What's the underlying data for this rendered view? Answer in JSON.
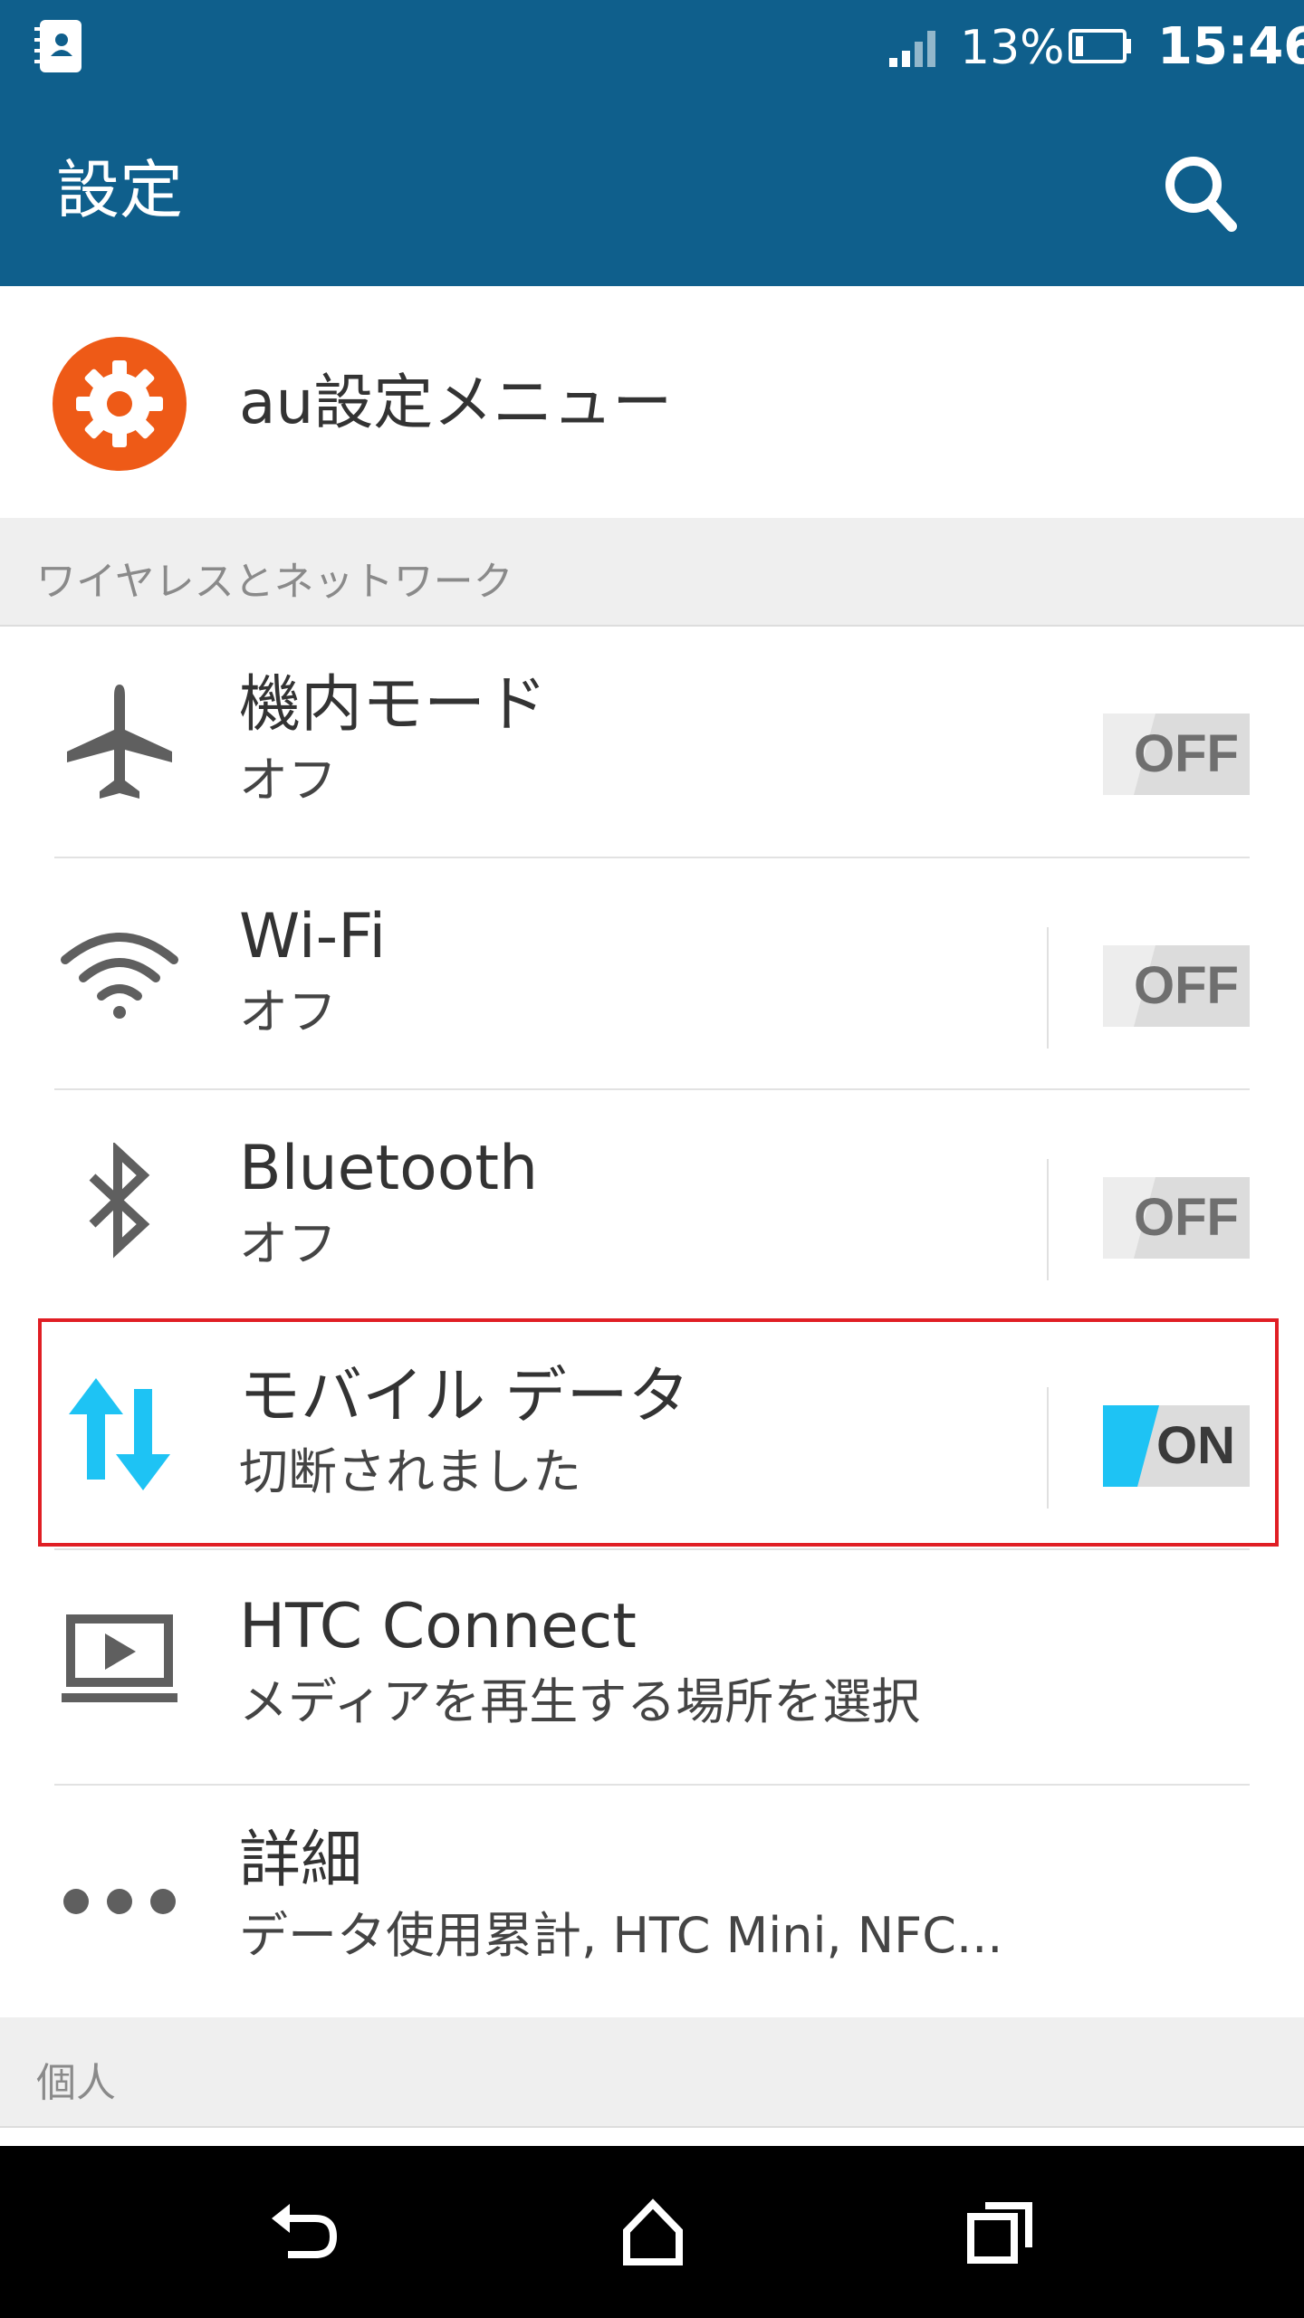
{
  "status_bar": {
    "battery": "13%",
    "time": "15:46",
    "app_icon": "contacts-icon",
    "signal_icon": "signal-icon",
    "battery_icon": "battery-icon"
  },
  "app_bar": {
    "title": "設定",
    "search_icon": "search-icon",
    "color": "#0f5f8c"
  },
  "au_menu": {
    "label": "au設定メニュー",
    "icon": "gear-icon",
    "icon_color": "#ee5a17"
  },
  "sections": {
    "wireless": "ワイヤレスとネットワーク",
    "personal": "個人"
  },
  "rows": {
    "airplane": {
      "title": "機内モード",
      "subtitle": "オフ",
      "icon": "airplane-icon",
      "toggle": "OFF"
    },
    "wifi": {
      "title": "Wi-Fi",
      "subtitle": "オフ",
      "icon": "wifi-icon",
      "toggle": "OFF"
    },
    "bluetooth": {
      "title": "Bluetooth",
      "subtitle": "オフ",
      "icon": "bluetooth-icon",
      "toggle": "OFF"
    },
    "mobile_data": {
      "title": "モバイル データ",
      "subtitle": "切断されました",
      "icon": "mobile-data-icon",
      "toggle": "ON",
      "accent": "#1ec3f4"
    },
    "htc_connect": {
      "title": "HTC Connect",
      "subtitle": "メディアを再生する場所を選択",
      "icon": "cast-screen-icon"
    },
    "more": {
      "title": "詳細",
      "subtitle": "データ使用累計, HTC Mini, NFC...",
      "icon": "more-dots-icon"
    }
  },
  "nav": {
    "back_icon": "back-icon",
    "home_icon": "home-icon",
    "recents_icon": "recents-icon"
  },
  "highlight_color": "#e01e24"
}
